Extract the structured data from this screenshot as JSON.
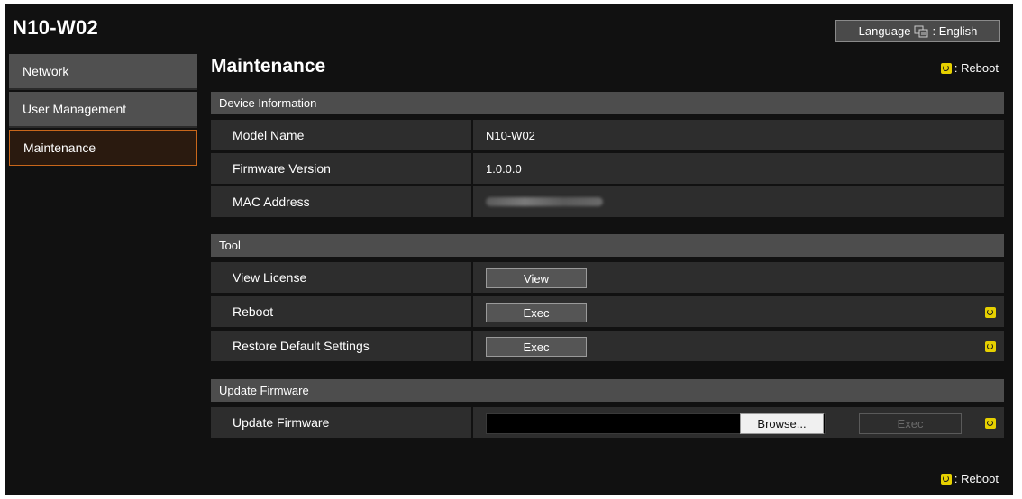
{
  "app": {
    "title": "N10-W02"
  },
  "language": {
    "label": "Language",
    "value": ": English"
  },
  "sidebar": {
    "items": [
      {
        "label": "Network"
      },
      {
        "label": "User Management"
      },
      {
        "label": "Maintenance"
      }
    ]
  },
  "page": {
    "title": "Maintenance"
  },
  "reboot_note": {
    "text": ": Reboot"
  },
  "colors": {
    "accent": "#c8671b",
    "reboot_icon": "#e6d000",
    "background": "#111111"
  },
  "sections": {
    "device_info": {
      "header": "Device Information",
      "rows": [
        {
          "label": "Model Name",
          "value": "N10-W02"
        },
        {
          "label": "Firmware Version",
          "value": "1.0.0.0"
        },
        {
          "label": "MAC Address"
        }
      ]
    },
    "tool": {
      "header": "Tool",
      "rows": [
        {
          "label": "View License",
          "button": "View"
        },
        {
          "label": "Reboot",
          "button": "Exec"
        },
        {
          "label": "Restore Default Settings",
          "button": "Exec"
        }
      ]
    },
    "update_firmware": {
      "header": "Update Firmware",
      "row": {
        "label": "Update Firmware",
        "browse": "Browse...",
        "exec": "Exec"
      }
    }
  },
  "icons": {
    "language": "language-icon",
    "reboot": "reboot-required-icon"
  }
}
